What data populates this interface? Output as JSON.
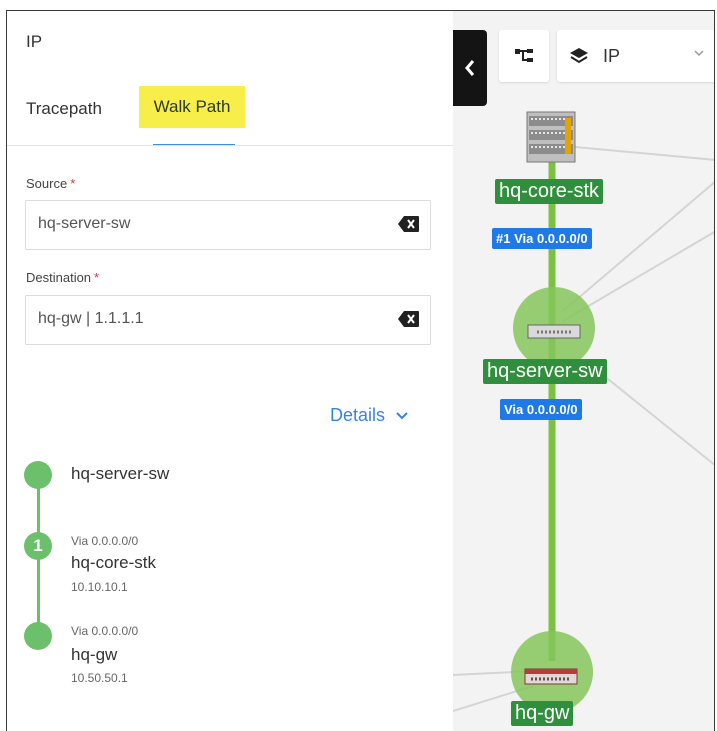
{
  "panel": {
    "title": "IP",
    "tabs": [
      {
        "label": "Tracepath",
        "active": false
      },
      {
        "label": "Walk Path",
        "active": true
      }
    ],
    "source": {
      "label": "Source",
      "required_mark": "*",
      "value": "hq-server-sw"
    },
    "destination": {
      "label": "Destination",
      "required_mark": "*",
      "value": "hq-gw | 1.1.1.1"
    },
    "details_label": "Details",
    "path": [
      {
        "step": "",
        "via": "",
        "name": "hq-server-sw",
        "ip": ""
      },
      {
        "step": "1",
        "via": "Via 0.0.0.0/0",
        "name": "hq-core-stk",
        "ip": "10.10.10.1"
      },
      {
        "step": "",
        "via": "Via 0.0.0.0/0",
        "name": "hq-gw",
        "ip": "10.50.50.1"
      }
    ]
  },
  "map": {
    "layer_label": "IP",
    "devices": [
      {
        "name": "hq-core-stk",
        "via": "#1 Via 0.0.0.0/0",
        "icon": "switch-stack-icon"
      },
      {
        "name": "hq-server-sw",
        "via": "Via 0.0.0.0/0",
        "icon": "switch-icon"
      },
      {
        "name": "hq-gw",
        "via": "",
        "icon": "firewall-icon"
      }
    ],
    "colors": {
      "path": "#7cc142",
      "label_bg": "#2f8f3c",
      "via_badge": "#1f79e6",
      "link": "#d4d4d4"
    }
  }
}
